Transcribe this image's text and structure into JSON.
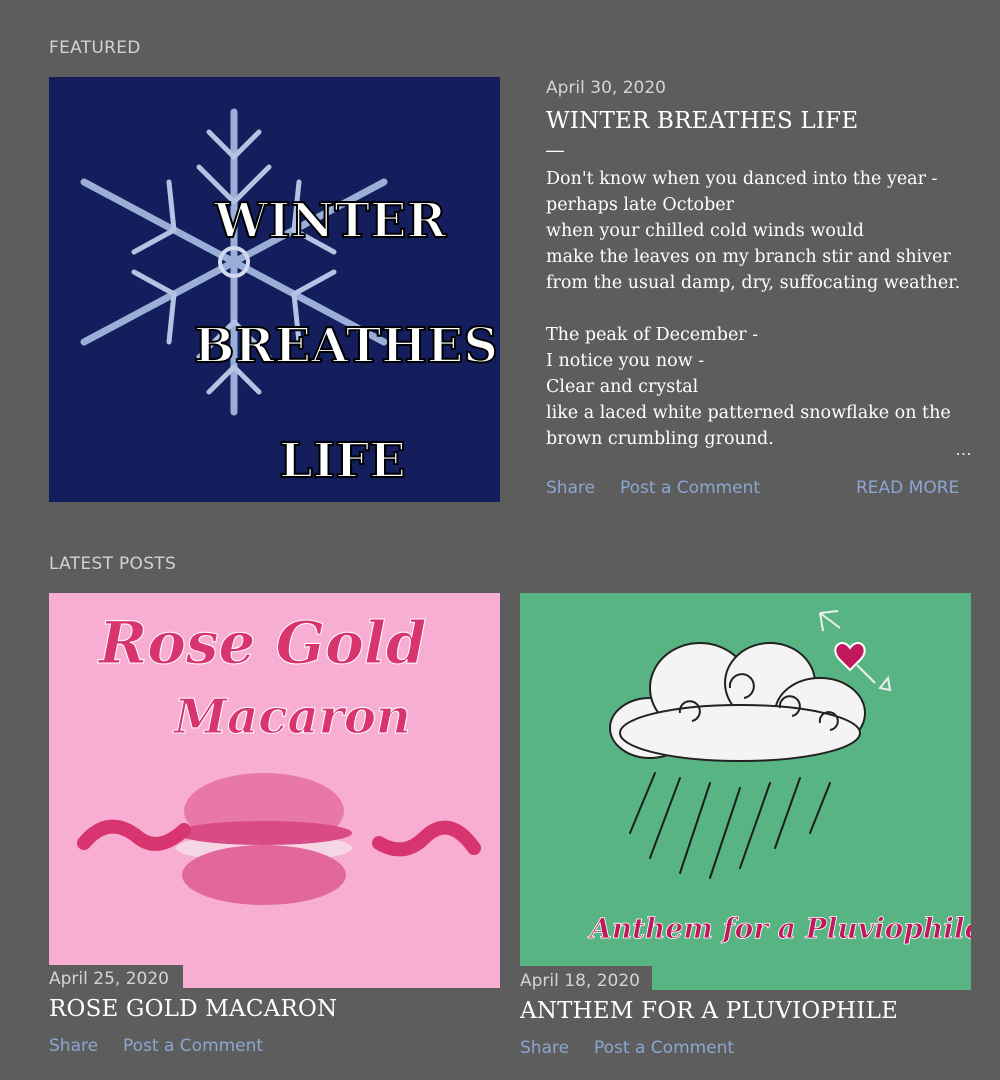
{
  "featured": {
    "section_label": "FEATURED",
    "date": "April 30, 2020",
    "title": "WINTER BREATHES LIFE",
    "dash": "—",
    "snippet": "Don't know when you danced into the year -\nperhaps late October\nwhen your chilled cold winds would\nmake the leaves on my branch stir and shiver\nfrom the usual damp, dry, suffocating weather.\n\nThe peak of December -\nI notice you now -\nClear and crystal\nlike a laced white patterned snowflake on the\nbrown crumbling ground.",
    "ellipsis": "…",
    "share_label": "Share",
    "comment_label": "Post a Comment",
    "read_more_label": "READ MORE",
    "image": {
      "line1": "WINTER",
      "line2": "BREATHES",
      "line3": "LIFE",
      "bg_color": "#141e5d",
      "icon": "snowflake-icon"
    }
  },
  "latest": {
    "section_label": "LATEST POSTS",
    "posts": [
      {
        "date": "April 25, 2020",
        "title": "ROSE GOLD MACARON",
        "share_label": "Share",
        "comment_label": "Post a Comment",
        "image": {
          "line1": "Rose Gold",
          "line2": "Macaron",
          "bg_color": "#f8aed2",
          "accent": "#d8346f",
          "icon": "macaron-icon"
        }
      },
      {
        "date": "April 18, 2020",
        "title": "ANTHEM FOR A PLUVIOPHILE",
        "share_label": "Share",
        "comment_label": "Post a Comment",
        "image": {
          "caption": "Anthem for a Pluviophile",
          "bg_color": "#58b583",
          "accent": "#c0175d",
          "icon": "rain-cloud-icon"
        }
      }
    ]
  }
}
